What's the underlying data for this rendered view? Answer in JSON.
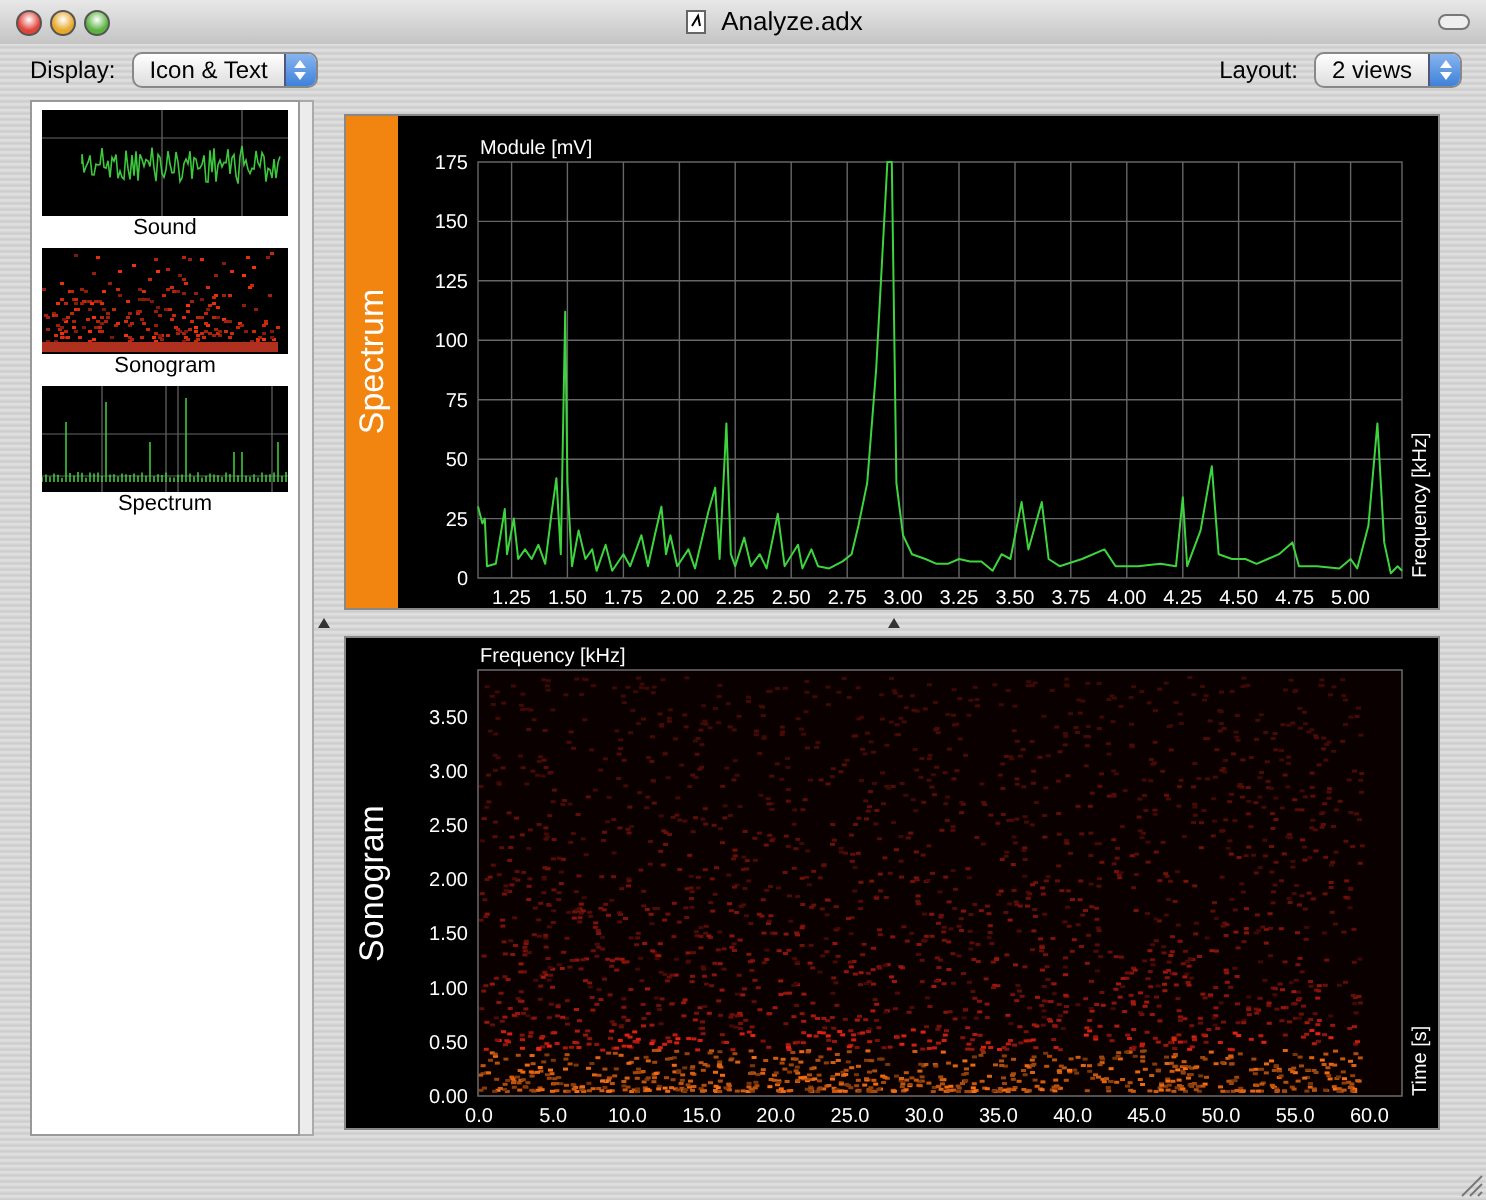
{
  "window": {
    "title": "Analyze.adx"
  },
  "toolbar": {
    "display": {
      "label": "Display:",
      "value": "Icon & Text"
    },
    "layout": {
      "label": "Layout:",
      "value": "2 views"
    }
  },
  "sidebar": {
    "items": [
      {
        "label": "Sound",
        "kind": "waveform"
      },
      {
        "label": "Sonogram",
        "kind": "sonogram"
      },
      {
        "label": "Spectrum",
        "kind": "spectrum"
      }
    ]
  },
  "views": [
    {
      "kind": "spectrum",
      "title": "Spectrum",
      "selected": true,
      "side_label": "Frequency [kHz]",
      "chart_data": {
        "type": "line",
        "grid": true,
        "ylabel": "Module [mV]",
        "xlim": [
          1.1,
          5.23
        ],
        "ylim": [
          0,
          175
        ],
        "xticks": [
          {
            "value": 1.25,
            "label": "1.25"
          },
          {
            "value": 1.5,
            "label": "1.50"
          },
          {
            "value": 1.75,
            "label": "1.75"
          },
          {
            "value": 2,
            "label": "2.00"
          },
          {
            "value": 2.25,
            "label": "2.25"
          },
          {
            "value": 2.5,
            "label": "2.50"
          },
          {
            "value": 2.75,
            "label": "2.75"
          },
          {
            "value": 3,
            "label": "3.00"
          },
          {
            "value": 3.25,
            "label": "3.25"
          },
          {
            "value": 3.5,
            "label": "3.50"
          },
          {
            "value": 3.75,
            "label": "3.75"
          },
          {
            "value": 4,
            "label": "4.00"
          },
          {
            "value": 4.25,
            "label": "4.25"
          },
          {
            "value": 4.5,
            "label": "4.50"
          },
          {
            "value": 4.75,
            "label": "4.75"
          },
          {
            "value": 5,
            "label": "5.00"
          }
        ],
        "yticks": [
          0,
          25,
          50,
          75,
          100,
          125,
          150,
          175
        ],
        "x": [
          1.1,
          1.12,
          1.13,
          1.14,
          1.18,
          1.22,
          1.23,
          1.26,
          1.28,
          1.31,
          1.34,
          1.37,
          1.4,
          1.43,
          1.45,
          1.47,
          1.49,
          1.5,
          1.52,
          1.55,
          1.58,
          1.61,
          1.63,
          1.67,
          1.7,
          1.75,
          1.78,
          1.83,
          1.86,
          1.89,
          1.92,
          1.94,
          1.96,
          1.99,
          2.04,
          2.07,
          2.13,
          2.16,
          2.18,
          2.21,
          2.23,
          2.25,
          2.29,
          2.32,
          2.36,
          2.39,
          2.44,
          2.47,
          2.53,
          2.55,
          2.59,
          2.62,
          2.67,
          2.73,
          2.77,
          2.8,
          2.84,
          2.88,
          2.93,
          2.95,
          2.97,
          3,
          3.04,
          3.1,
          3.15,
          3.2,
          3.25,
          3.3,
          3.35,
          3.4,
          3.44,
          3.48,
          3.53,
          3.56,
          3.62,
          3.65,
          3.7,
          3.8,
          3.9,
          3.95,
          4.05,
          4.15,
          4.22,
          4.25,
          4.27,
          4.33,
          4.38,
          4.41,
          4.47,
          4.53,
          4.58,
          4.63,
          4.68,
          4.74,
          4.77,
          4.85,
          4.95,
          5,
          5.03,
          5.08,
          5.12,
          5.15,
          5.18,
          5.21,
          5.23
        ],
        "values": [
          30,
          23,
          25,
          5,
          6,
          29,
          10,
          25,
          8,
          12,
          8,
          14,
          6,
          28,
          42,
          10,
          112,
          40,
          5,
          20,
          8,
          12,
          3,
          14,
          3,
          10,
          5,
          18,
          5,
          18,
          30,
          10,
          18,
          5,
          12,
          4,
          28,
          38,
          8,
          65,
          10,
          5,
          17,
          5,
          10,
          4,
          27,
          5,
          14,
          4,
          12,
          5,
          4,
          7,
          10,
          22,
          40,
          88,
          175,
          175,
          40,
          18,
          10,
          8,
          6,
          6,
          8,
          7,
          7,
          3,
          10,
          8,
          32,
          12,
          32,
          8,
          5,
          8,
          12,
          5,
          5,
          6,
          5,
          34,
          5,
          20,
          47,
          10,
          8,
          8,
          6,
          8,
          10,
          15,
          5,
          5,
          4,
          8,
          4,
          22,
          65,
          15,
          2,
          5,
          3
        ]
      }
    },
    {
      "kind": "sonogram",
      "title": "Sonogram",
      "selected": false,
      "ylabel": "Frequency [kHz]",
      "xlabel": "Time [s]",
      "yticks": [
        "3.50",
        "3.00",
        "2.50",
        "2.00",
        "1.50",
        "1.00",
        "0.50",
        "0.00"
      ],
      "xticks": [
        "0.0",
        "5.0",
        "10.0",
        "15.0",
        "20.0",
        "25.0",
        "30.0",
        "35.0",
        "40.0",
        "45.0",
        "50.0",
        "55.0",
        "60.0"
      ]
    }
  ]
}
